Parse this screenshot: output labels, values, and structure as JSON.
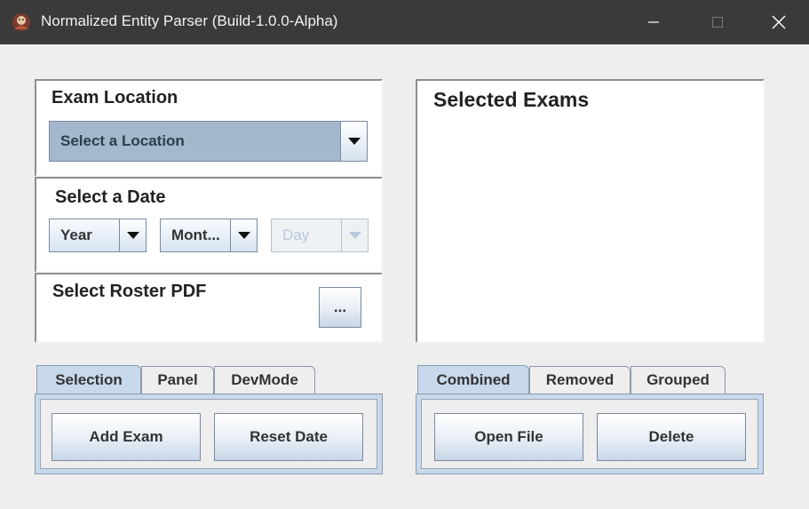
{
  "window": {
    "title": "Normalized Entity Parser (Build-1.0.0-Alpha)",
    "icon": "app-emblem-icon",
    "controls": {
      "minimize": "minimize-icon",
      "maximize": "maximize-icon",
      "close": "close-icon"
    }
  },
  "location": {
    "label": "Exam Location",
    "selected": "Select a Location"
  },
  "date": {
    "label": "Select a Date",
    "year": "Year",
    "month": "Mont...",
    "day": "Day"
  },
  "roster": {
    "label": "Select Roster PDF",
    "browse_label": "..."
  },
  "selected_exams": {
    "title": "Selected Exams"
  },
  "left_tabs": {
    "tabs": [
      "Selection",
      "Panel",
      "DevMode"
    ],
    "active": "Selection",
    "add_exam": "Add Exam",
    "reset_date": "Reset Date"
  },
  "right_tabs": {
    "tabs": [
      "Combined",
      "Removed",
      "Grouped"
    ],
    "active": "Combined",
    "open_file": "Open File",
    "delete": "Delete"
  },
  "colors": {
    "titlebar": "#3a3a3a",
    "client_bg": "#eeeeee",
    "active_tab": "#c9d9ec",
    "combo_selected": "#a3b8cc"
  }
}
